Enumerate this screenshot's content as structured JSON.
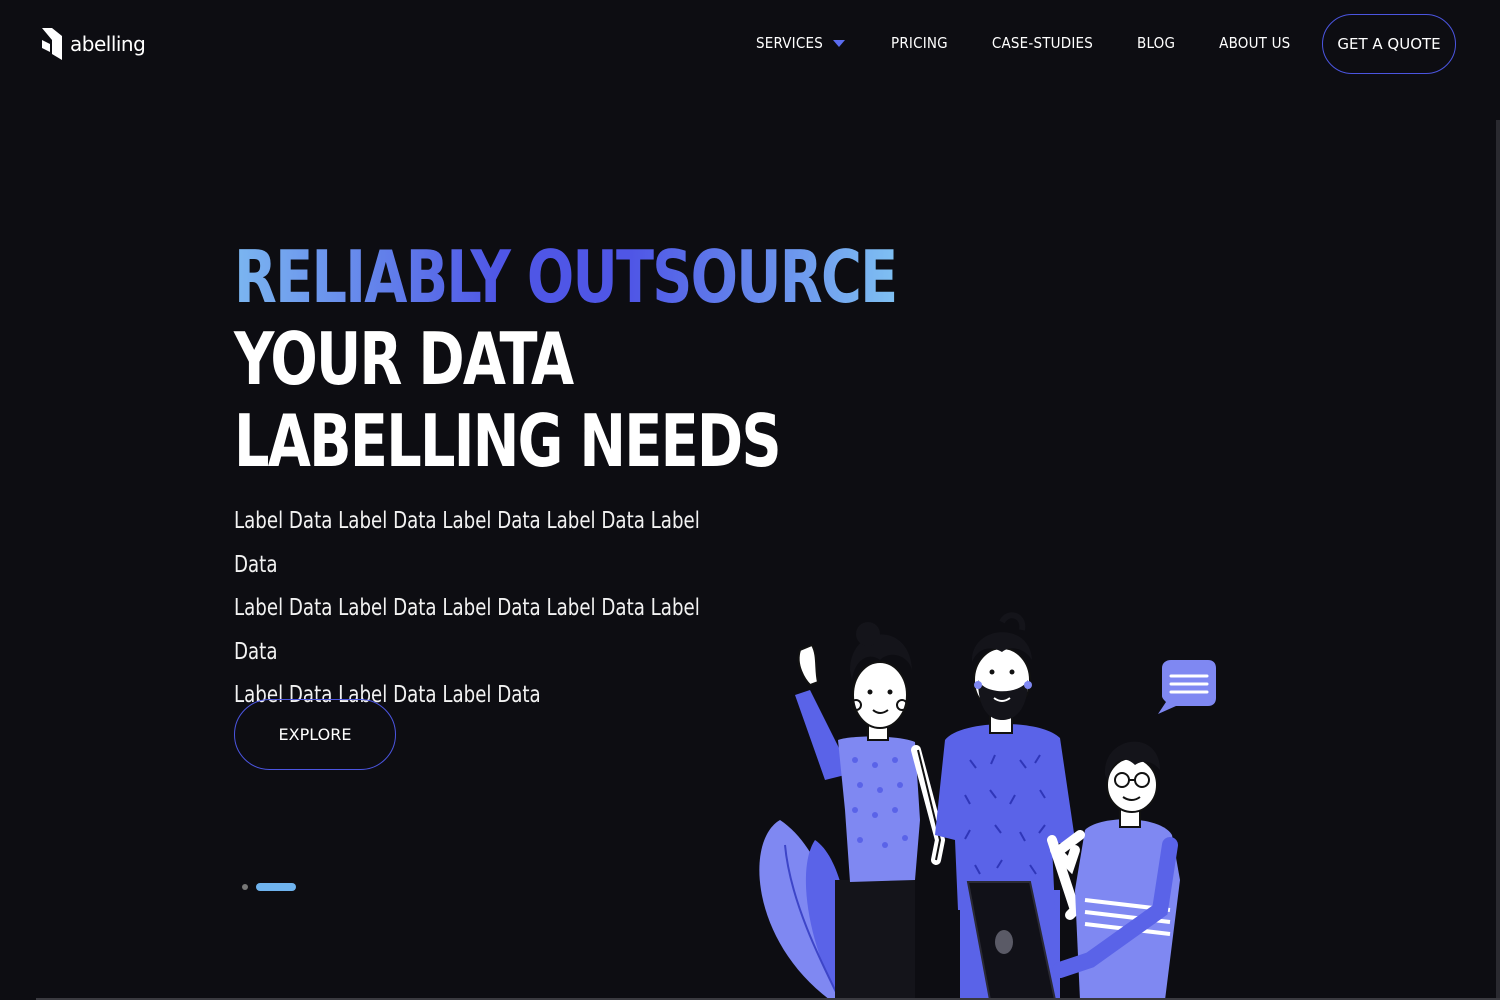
{
  "brand": {
    "name": "abelling"
  },
  "nav": {
    "items": [
      {
        "label": "SERVICES",
        "has_dropdown": true
      },
      {
        "label": "PRICING"
      },
      {
        "label": "CASE-STUDIES"
      },
      {
        "label": "BLOG"
      },
      {
        "label": "ABOUT US"
      }
    ],
    "cta_label": "GET A QUOTE"
  },
  "hero": {
    "headline": {
      "line1": "RELIABLY OUTSOURCE",
      "line2": "YOUR DATA",
      "line3": "LABELLING NEEDS"
    },
    "subtext": [
      "Label Data Label Data Label Data Label Data Label Data",
      "Label Data Label Data Label Data Label Data Label Data",
      "Label Data Label Data Label Data"
    ],
    "explore_label": "EXPLORE"
  },
  "carousel": {
    "count": 2,
    "active_index": 1
  },
  "colors": {
    "background": "#0d0d12",
    "accent": "#4f56e6",
    "accent_light": "#7bb6f0",
    "illustration_primary": "#5a63e8",
    "illustration_light": "#7f88f2"
  },
  "icons": {
    "logo": "abelling-logo-icon",
    "dropdown": "caret-down-icon",
    "chat": "chat-bubble-icon"
  }
}
